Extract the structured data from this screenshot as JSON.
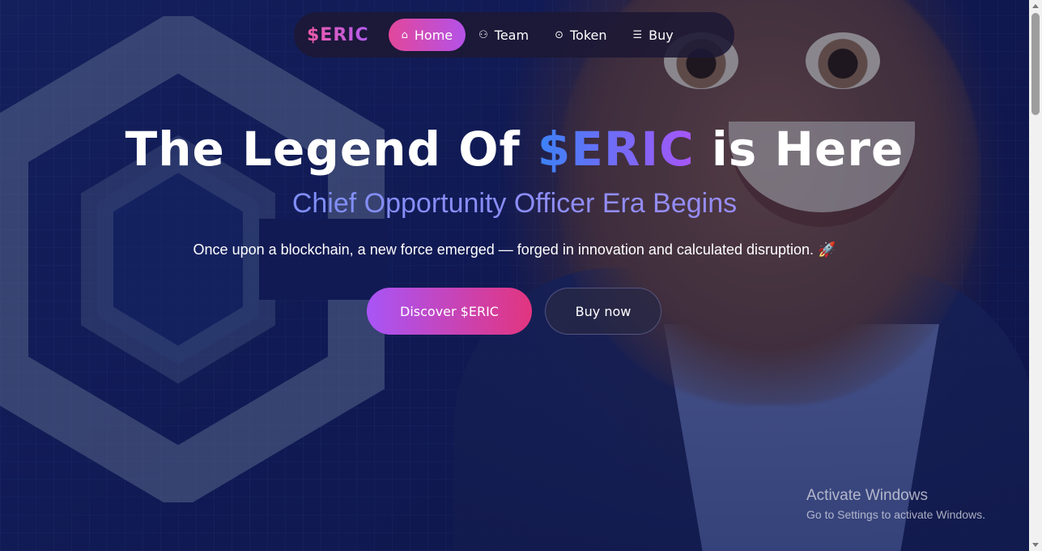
{
  "nav": {
    "brand": "$ERIC",
    "items": [
      {
        "label": "Home",
        "icon": "home-icon",
        "glyph": "⌂",
        "active": true
      },
      {
        "label": "Team",
        "icon": "team-icon",
        "glyph": "⚇",
        "active": false
      },
      {
        "label": "Token",
        "icon": "token-icon",
        "glyph": "⊙",
        "active": false
      },
      {
        "label": "Buy",
        "icon": "cart-icon",
        "glyph": "☰",
        "active": false
      }
    ]
  },
  "hero": {
    "title_before": "The Legend Of ",
    "title_accent": "$ERIC",
    "title_after": " is Here",
    "subtitle": "Chief Opportunity Officer Era Begins",
    "tagline": "Once upon a blockchain, a new force emerged — forged in innovation and calculated disruption. 🚀",
    "primary_button": "Discover $ERIC",
    "secondary_button": "Buy now"
  },
  "watermark": {
    "line1": "Activate Windows",
    "line2": "Go to Settings to activate Windows."
  },
  "colors": {
    "accent_pink": "#e2479b",
    "accent_purple": "#a855f7",
    "accent_blue": "#3b82f6"
  }
}
